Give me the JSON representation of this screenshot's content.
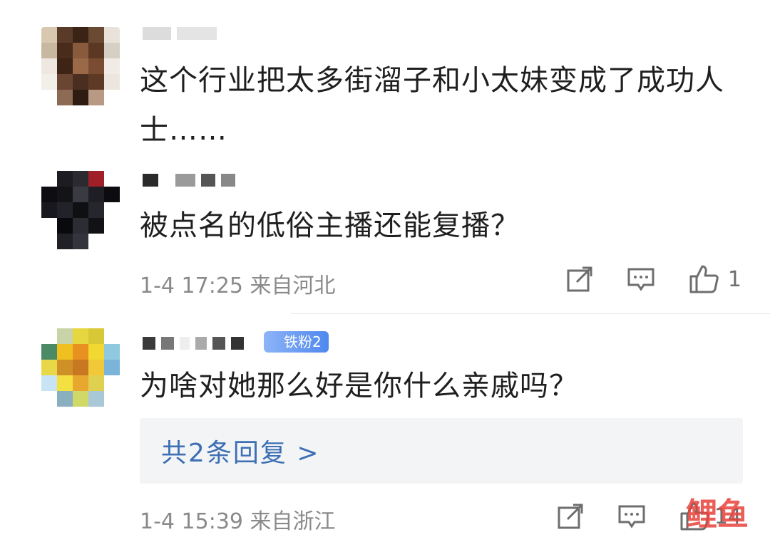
{
  "comments": [
    {
      "text": "这个行业把太多街溜子和小太妹变成了成功人士……"
    },
    {
      "text": "被点名的低俗主播还能复播？",
      "meta": "1-4 17:25 来自河北",
      "like_count": "1"
    },
    {
      "badge": "铁粉2",
      "text": "为啥对她那么好是你什么亲戚吗？",
      "reply_link": "共2条回复 >",
      "meta": "1-4 15:39 来自浙江",
      "like_count": "14"
    }
  ],
  "watermark": "鲤鱼",
  "icons": {
    "share": "share-icon",
    "comment": "comment-icon",
    "like": "thumbs-up-icon"
  },
  "colors": {
    "link": "#3d6fb4",
    "badge": "#4f88ee",
    "meta": "#8a8a8a"
  }
}
